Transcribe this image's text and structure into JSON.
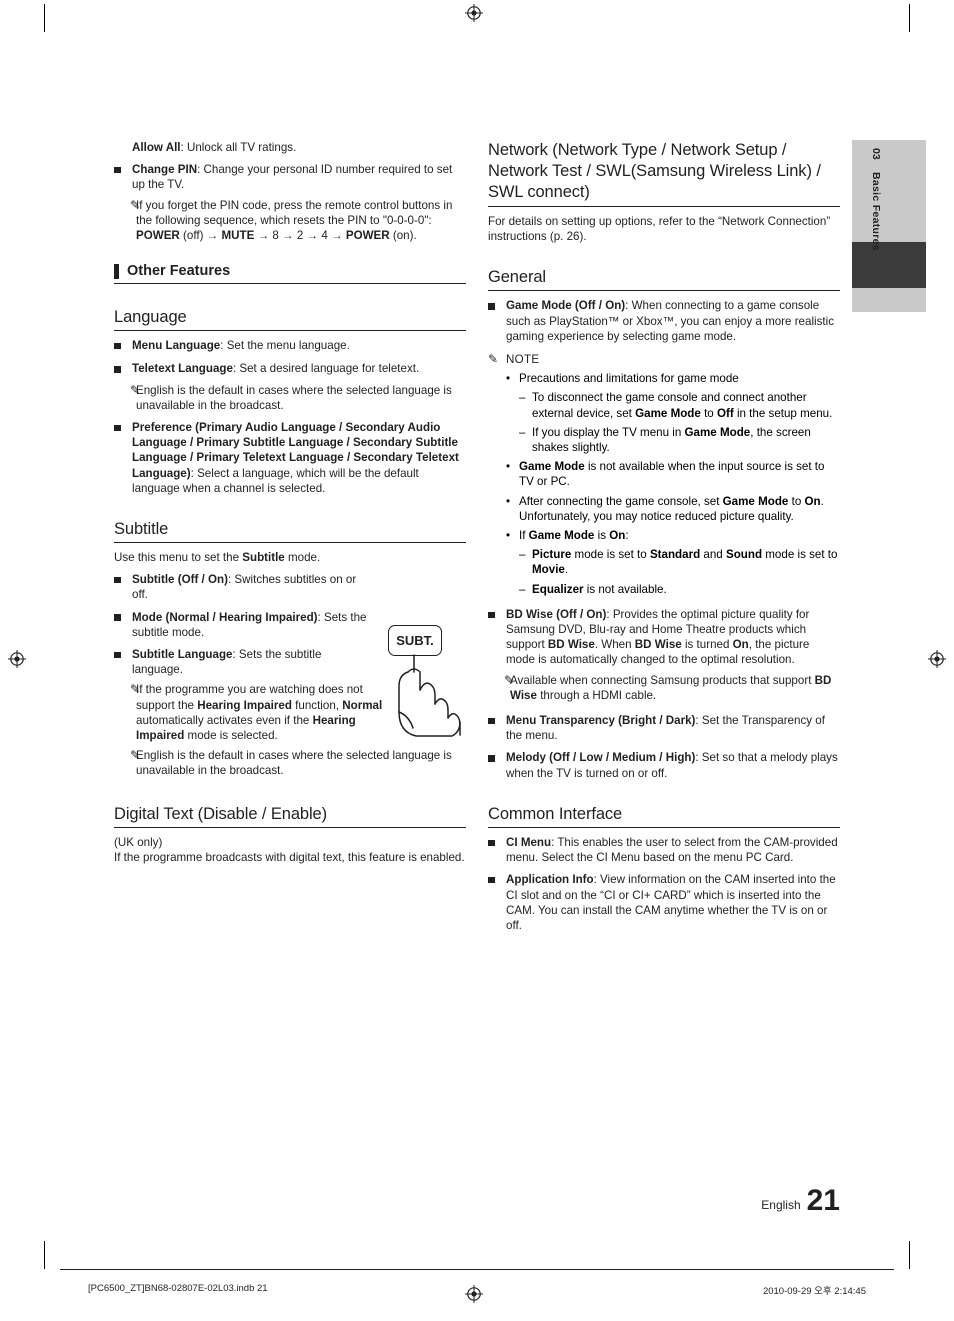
{
  "page": {
    "number": "21",
    "language_label": "English",
    "side_tab": {
      "chapter_number": "03",
      "chapter_title": "Basic Features"
    }
  },
  "footer": {
    "left": "[PC6500_ZT]BN68-02807E-02L03.indb   21",
    "right": "2010-09-29   오후 2:14:45"
  },
  "left_column": {
    "allow_all": {
      "bold": "Allow All",
      "rest": ": Unlock all TV ratings."
    },
    "change_pin": {
      "bold": "Change PIN",
      "rest": ": Change your personal ID number required to set up the TV."
    },
    "change_pin_note_1": "If you forget the PIN code, press the remote control buttons in the following sequence, which resets the PIN to \"0-0-0-0\": ",
    "change_pin_note_bold_1": "POWER",
    "change_pin_note_2": " (off) → ",
    "change_pin_note_bold_2": "MUTE",
    "change_pin_note_3": " → 8 → 2 → 4 → ",
    "change_pin_note_bold_3": "POWER",
    "change_pin_note_4": " (on).",
    "other_features_heading": "Other Features",
    "language_heading": "Language",
    "menu_language": {
      "bold": "Menu Language",
      "rest": ": Set the menu language."
    },
    "teletext_language": {
      "bold": "Teletext Language",
      "rest": ": Set a desired language for teletext."
    },
    "teletext_note": "English is the default in cases where the selected language is unavailable in the broadcast.",
    "preference": {
      "bold": "Preference (Primary Audio Language / Secondary Audio Language / Primary Subtitle Language / Secondary Subtitle Language / Primary Teletext Language / Secondary Teletext Language)",
      "rest": ": Select a language, which will be the default language when a channel is selected."
    },
    "subtitle_heading": "Subtitle",
    "subtitle_intro_1": "Use this menu to set the ",
    "subtitle_intro_bold": "Subtitle",
    "subtitle_intro_2": " mode.",
    "subtitle_onoff": {
      "bold": "Subtitle (Off / On)",
      "rest": ": Switches subtitles on or off."
    },
    "mode_normal": {
      "bold": "Mode (Normal / Hearing Impaired)",
      "rest": ": Sets the subtitle mode."
    },
    "subtitle_language": {
      "bold": "Subtitle Language",
      "rest": ": Sets the subtitle language."
    },
    "subtitle_note_1_a": "If the programme you are watching does not support the ",
    "subtitle_note_1_b": "Hearing Impaired",
    "subtitle_note_1_c": " function, ",
    "subtitle_note_1_d": "Normal",
    "subtitle_note_1_e": " automatically activates even if the ",
    "subtitle_note_1_f": "Hearing Impaired",
    "subtitle_note_1_g": " mode is selected.",
    "subtitle_note_2": "English is the default in cases where the selected language is unavailable in the broadcast.",
    "digital_text_heading": "Digital Text (Disable / Enable)",
    "digital_text_uk": "(UK only)",
    "digital_text_body": "If the programme broadcasts with digital text, this feature is enabled.",
    "subt_button_label": "SUBT."
  },
  "right_column": {
    "network_heading": "Network (Network Type / Network Setup / Network Test / SWL(Samsung Wireless Link) / SWL connect)",
    "network_body": "For details on setting up options, refer to the “Network Connection” instructions (p. 26).",
    "general_heading": "General",
    "game_mode": {
      "bold": "Game Mode (Off / On)",
      "rest": ": When connecting to a game console such as PlayStation™ or Xbox™, you can enjoy a more realistic gaming experience by selecting game mode."
    },
    "note_label": "NOTE",
    "note_1": "Precautions and limitations for game mode",
    "note_1_sub_1_a": "To disconnect the game console and connect another external device, set ",
    "note_1_sub_1_b": "Game Mode",
    "note_1_sub_1_c": " to ",
    "note_1_sub_1_d": "Off",
    "note_1_sub_1_e": " in the setup menu.",
    "note_1_sub_2_a": "If you display the TV menu in ",
    "note_1_sub_2_b": "Game Mode",
    "note_1_sub_2_c": ", the screen shakes slightly.",
    "note_2_a": "Game Mode",
    "note_2_b": " is not available when the input source is set to TV or PC.",
    "note_3_a": "After connecting the game console, set ",
    "note_3_b": "Game Mode",
    "note_3_c": " to ",
    "note_3_d": "On",
    "note_3_e": ". Unfortunately, you may notice reduced picture quality.",
    "note_4_a": "If ",
    "note_4_b": "Game Mode",
    "note_4_c": " is ",
    "note_4_d": "On",
    "note_4_e": ":",
    "note_4_sub_1_a": "Picture",
    "note_4_sub_1_b": " mode is set to ",
    "note_4_sub_1_c": "Standard",
    "note_4_sub_1_d": " and ",
    "note_4_sub_1_e": "Sound",
    "note_4_sub_1_f": " mode is set to ",
    "note_4_sub_1_g": "Movie",
    "note_4_sub_1_h": ".",
    "note_4_sub_2_a": "Equalizer",
    "note_4_sub_2_b": " is not available.",
    "bd_wise_a": "BD Wise (Off / On)",
    "bd_wise_b": ": Provides the optimal picture quality for Samsung DVD, Blu-ray and Home Theatre products which support ",
    "bd_wise_c": "BD Wise",
    "bd_wise_d": ". When ",
    "bd_wise_e": "BD Wise",
    "bd_wise_f": " is turned ",
    "bd_wise_g": "On",
    "bd_wise_h": ", the picture mode is automatically changed to the optimal resolution.",
    "bd_wise_note_a": "Available when connecting Samsung products that support ",
    "bd_wise_note_b": "BD Wise",
    "bd_wise_note_c": " through a HDMI cable.",
    "menu_transparency": {
      "bold": "Menu Transparency (Bright / Dark)",
      "rest": ": Set the Transparency of the menu."
    },
    "melody": {
      "bold": "Melody (Off / Low / Medium / High)",
      "rest": ": Set so that a melody plays when the TV is turned on or off."
    },
    "common_interface_heading": "Common Interface",
    "ci_menu": {
      "bold": "CI Menu",
      "rest": ": This enables the user to select from the CAM-provided menu. Select the CI Menu based on the menu PC Card."
    },
    "application_info": {
      "bold": "Application Info",
      "rest": ": View information on the CAM inserted into the CI slot and on the “CI or CI+ CARD” which is inserted into the CAM. You can install the CAM anytime whether the TV is on or off."
    }
  },
  "colors": {
    "text": "#231f20",
    "tab_gray": "#c9c9c9",
    "tab_dark": "#3b3b3b"
  }
}
